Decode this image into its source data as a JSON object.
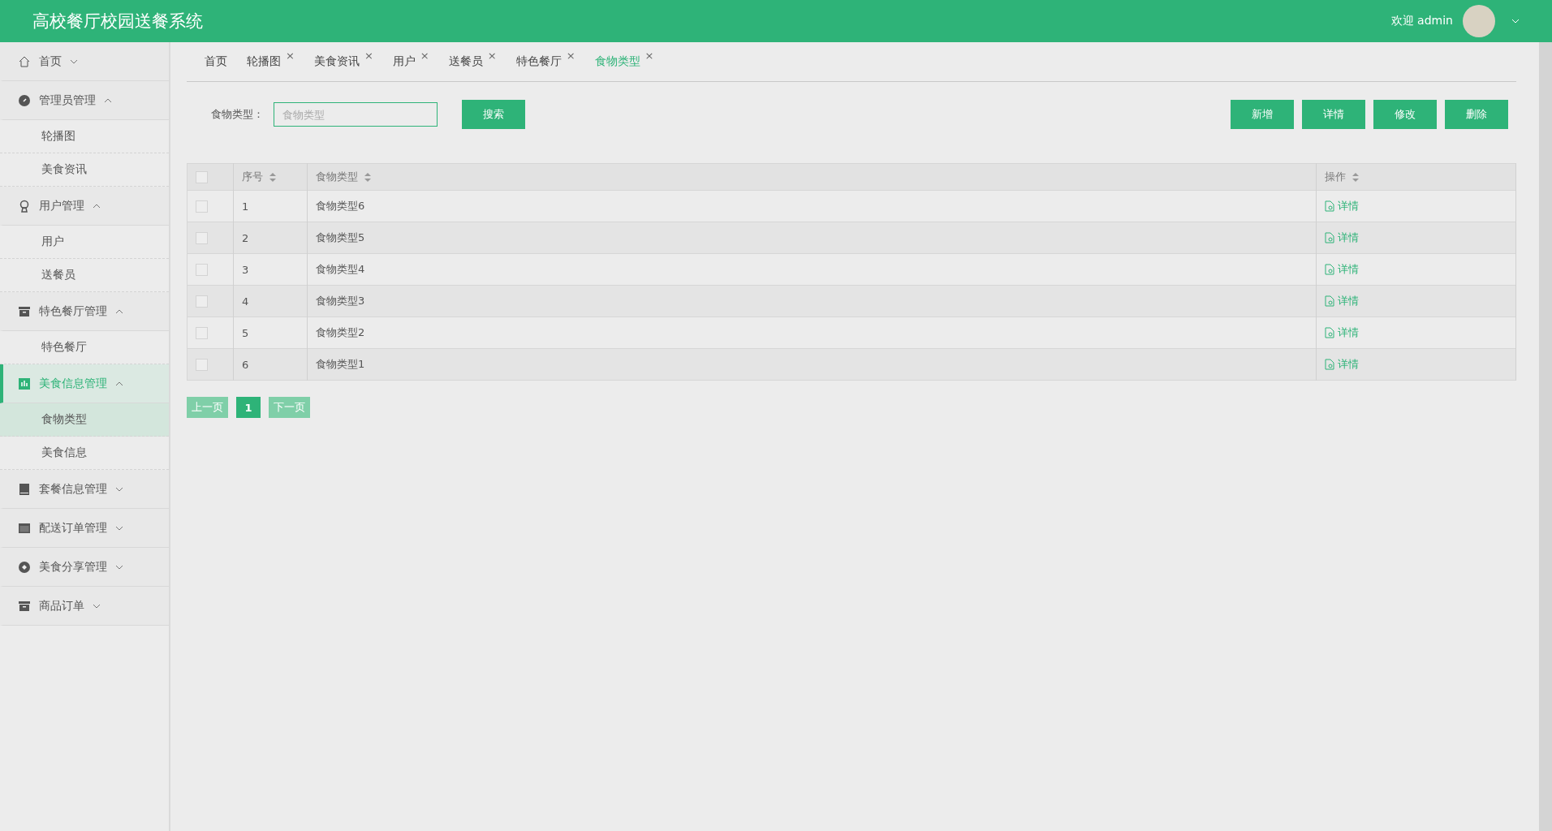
{
  "header": {
    "title": "高校餐厅校园送餐系统",
    "welcome": "欢迎 admin"
  },
  "sidebar": {
    "items": [
      {
        "label": "首页",
        "kind": "home",
        "expanded": false,
        "selected": false
      },
      {
        "label": "管理员管理",
        "kind": "compass",
        "expanded": true,
        "selected": false,
        "children": [
          {
            "label": "轮播图",
            "selected": false
          },
          {
            "label": "美食资讯",
            "selected": false
          }
        ]
      },
      {
        "label": "用户管理",
        "kind": "user",
        "expanded": true,
        "selected": false,
        "children": [
          {
            "label": "用户",
            "selected": false
          },
          {
            "label": "送餐员",
            "selected": false
          }
        ]
      },
      {
        "label": "特色餐厅管理",
        "kind": "box",
        "expanded": true,
        "selected": false,
        "children": [
          {
            "label": "特色餐厅",
            "selected": false
          }
        ]
      },
      {
        "label": "美食信息管理",
        "kind": "chart",
        "expanded": true,
        "selected": true,
        "children": [
          {
            "label": "食物类型",
            "selected": true
          },
          {
            "label": "美食信息",
            "selected": false
          }
        ]
      },
      {
        "label": "套餐信息管理",
        "kind": "drive",
        "expanded": false,
        "selected": false
      },
      {
        "label": "配送订单管理",
        "kind": "panel",
        "expanded": false,
        "selected": false
      },
      {
        "label": "美食分享管理",
        "kind": "disc",
        "expanded": false,
        "selected": false
      },
      {
        "label": "商品订单",
        "kind": "box",
        "expanded": false,
        "selected": false
      }
    ]
  },
  "tabs": [
    {
      "label": "首页",
      "selected": false
    },
    {
      "label": "轮播图",
      "close": "×",
      "selected": false
    },
    {
      "label": "美食资讯",
      "close": "×",
      "selected": false
    },
    {
      "label": "用户",
      "close": "×",
      "selected": false
    },
    {
      "label": "送餐员",
      "close": "×",
      "selected": false
    },
    {
      "label": "特色餐厅",
      "close": "×",
      "selected": false
    },
    {
      "label": "食物类型",
      "close": "×",
      "selected": true
    }
  ],
  "search": {
    "label": "食物类型：",
    "placeholder": "食物类型",
    "button": "搜索"
  },
  "actions": [
    "新增",
    "详情",
    "修改",
    "删除"
  ],
  "table": {
    "all_checked": false,
    "columns": [
      "序号",
      "食物类型",
      "操作"
    ],
    "rows": [
      {
        "index": "1",
        "name": "食物类型6",
        "action": "详情",
        "checked": false
      },
      {
        "index": "2",
        "name": "食物类型5",
        "action": "详情",
        "checked": false
      },
      {
        "index": "3",
        "name": "食物类型4",
        "action": "详情",
        "checked": false
      },
      {
        "index": "4",
        "name": "食物类型3",
        "action": "详情",
        "checked": false
      },
      {
        "index": "5",
        "name": "食物类型2",
        "action": "详情",
        "checked": false
      },
      {
        "index": "6",
        "name": "食物类型1",
        "action": "详情",
        "checked": false
      }
    ]
  },
  "pagination": {
    "prev": "上一页",
    "pages": [
      {
        "label": "1",
        "selected": true
      }
    ],
    "next": "下一页"
  }
}
